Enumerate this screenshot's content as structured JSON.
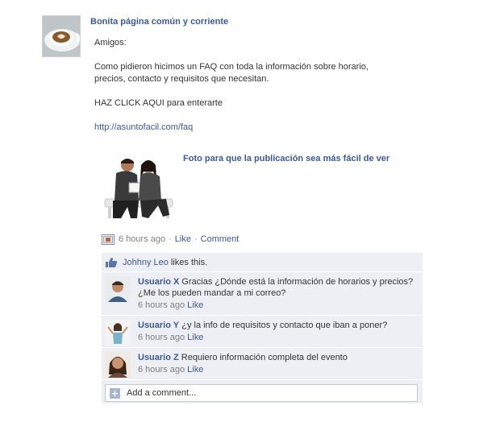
{
  "post": {
    "page_name": "Bonita página común y corriente",
    "paragraphs": [
      "Amigos:",
      "Como pidieron hicimos un FAQ con toda la información sobre horario, precios, contacto y requisitos que necesitan.",
      "HAZ CLICK AQUI para enterarte"
    ],
    "link": "http://asuntofacil.com/faq",
    "photo_caption": "Foto para que la publicación sea más fácil de ver",
    "time": "6 hours ago",
    "separator": "·",
    "like_label": "Like",
    "comment_label": "Comment",
    "icons": {
      "avatar": "coffee-cup-icon",
      "meta": "notes-icon"
    }
  },
  "likes": {
    "user": "Johhny Leo",
    "text": "likes this.",
    "icon": "thumbs-up-icon"
  },
  "comments": [
    {
      "author": "Usuario X",
      "text": "Gracias ¿Dónde está la información de horarios y precios? ¿Me los pueden mandar a mi correo?",
      "time": "6 hours ago",
      "like_label": "Like"
    },
    {
      "author": "Usuario Y",
      "text": "¿y la info de requisitos y contacto que iban a poner?",
      "time": "6 hours ago",
      "like_label": "Like"
    },
    {
      "author": "Usuario Z",
      "text": "Requiero información completa del evento",
      "time": "6 hours ago",
      "like_label": "Like"
    }
  ],
  "add_comment": {
    "placeholder": "Add a comment...",
    "icon": "plus-icon"
  },
  "colors": {
    "link": "#3b5998",
    "feedback_bg": "#edeff4",
    "meta_text": "#808080"
  }
}
